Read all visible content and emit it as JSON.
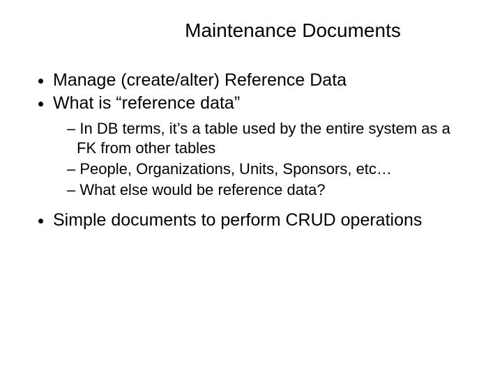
{
  "title": "Maintenance Documents",
  "bullets": {
    "b1": "Manage (create/alter) Reference Data",
    "b2": "What is “reference data”",
    "b2_sub": {
      "s1": "In DB terms, it’s a table used by the entire system as a FK from other tables",
      "s2": "People, Organizations, Units, Sponsors, etc…",
      "s3": "What else would be reference data?"
    },
    "b3": "Simple documents to perform CRUD operations"
  }
}
